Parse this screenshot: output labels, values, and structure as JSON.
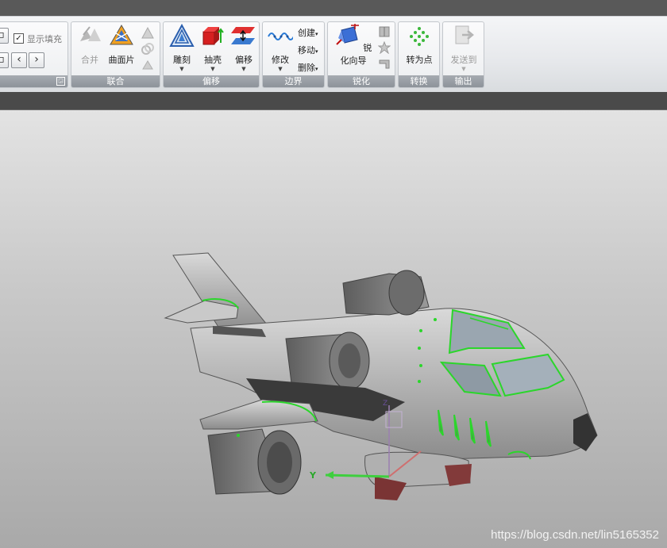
{
  "ribbon": {
    "group0": {
      "show_fill_label": "显示填充",
      "show_fill_checked": "✓"
    },
    "union": {
      "label": "联合",
      "merge_label": "合并",
      "patch_label": "曲面片"
    },
    "offset": {
      "label": "偏移",
      "carve_label": "雕刻",
      "shell_label": "抽壳",
      "offset_label": "偏移"
    },
    "boundary": {
      "label": "边界",
      "modify_label": "修改",
      "create_label": "创建",
      "move_label": "移动",
      "delete_label": "删除"
    },
    "sharpen": {
      "label": "锐化",
      "wizard_label": "锐化向导"
    },
    "convert": {
      "label": "转换",
      "to_points_label": "转为点"
    },
    "output": {
      "label": "输出",
      "send_to_label": "发送到"
    }
  },
  "viewport": {
    "axis_y_label": "Y",
    "axis_z_label": "Z",
    "watermark": "https://blog.csdn.net/lin5165352"
  },
  "colors": {
    "edge_highlight": "#2bd62b",
    "ribbon_label_bg": "#9aa0a6"
  }
}
